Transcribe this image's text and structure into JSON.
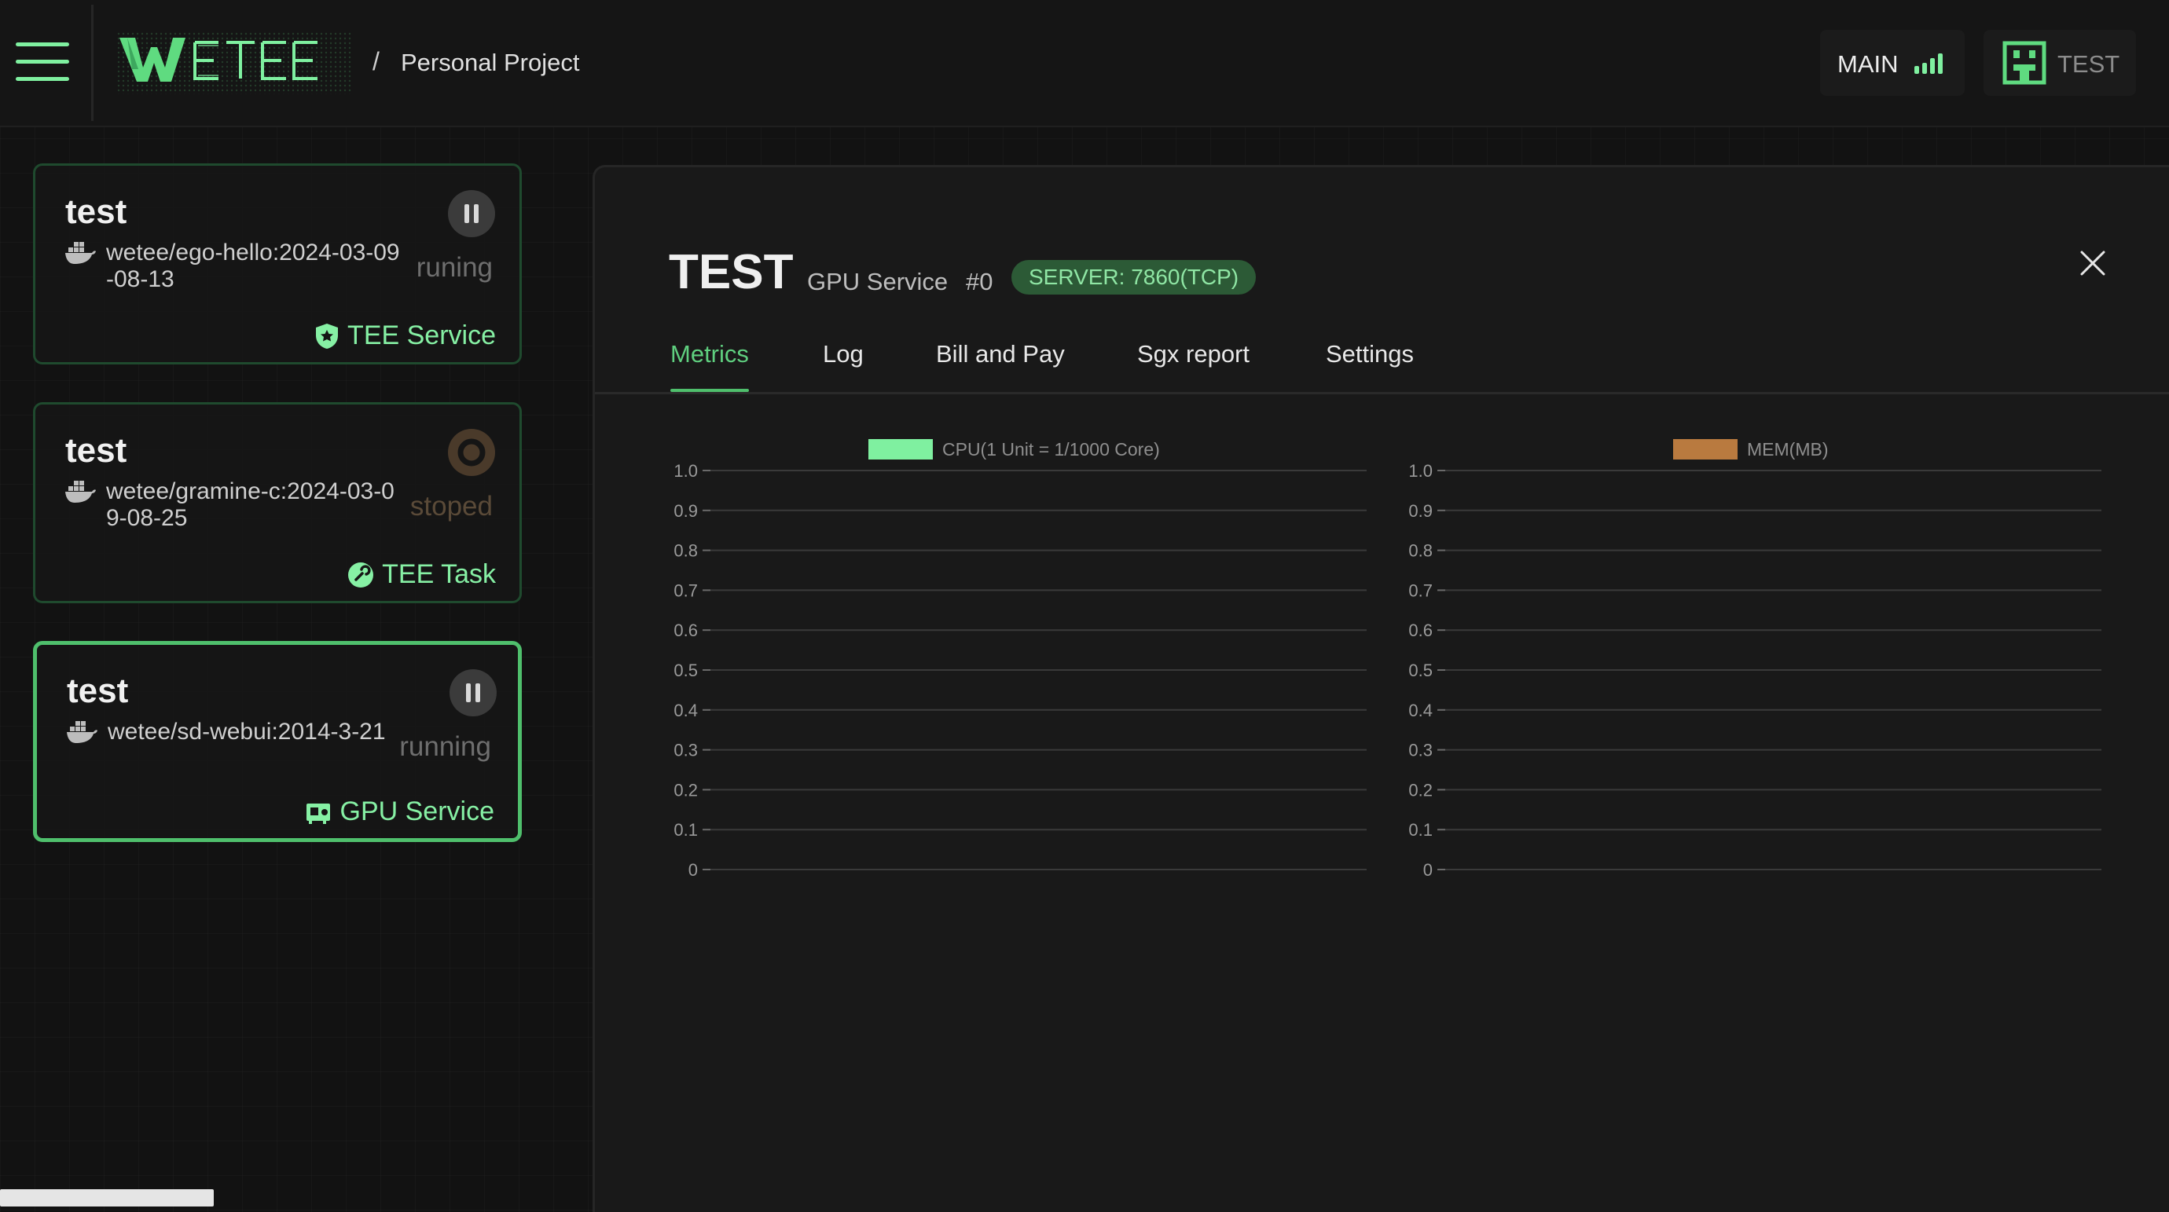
{
  "header": {
    "menu_icon": "hamburger-menu-icon",
    "brand": "WETEE",
    "breadcrumb_separator": "/",
    "project": "Personal Project",
    "network": {
      "label": "MAIN",
      "icon": "signal-bars-icon"
    },
    "account": {
      "name": "TEST",
      "icon": "user-avatar-icon"
    }
  },
  "sidebar": {
    "cards": [
      {
        "title": "test",
        "image": "wetee/ego-hello:2024-03-09-08-13",
        "status": "runing",
        "state_icon": "pause-icon",
        "type": "TEE Service",
        "type_icon": "shield-icon",
        "selected": false
      },
      {
        "title": "test",
        "image": "wetee/gramine-c:2024-03-09-08-25",
        "status": "stoped",
        "state_icon": "stopped-ring-icon",
        "type": "TEE Task",
        "type_icon": "task-icon",
        "selected": false
      },
      {
        "title": "test",
        "image": "wetee/sd-webui:2014-3-21",
        "status": "running",
        "state_icon": "pause-icon",
        "type": "GPU Service",
        "type_icon": "gpu-icon",
        "selected": true
      }
    ]
  },
  "detail": {
    "title": "TEST",
    "kind": "GPU Service",
    "index": "#0",
    "server": "SERVER: 7860(TCP)",
    "tabs": [
      {
        "label": "Metrics",
        "active": true
      },
      {
        "label": "Log",
        "active": false
      },
      {
        "label": "Bill and Pay",
        "active": false
      },
      {
        "label": "Sgx report",
        "active": false
      },
      {
        "label": "Settings",
        "active": false
      }
    ]
  },
  "colors": {
    "accent": "#4fbf6c",
    "accent_light": "#86f0a4",
    "cpu": "#7ff0a0",
    "mem": "#b97a3f",
    "background": "#121212",
    "panel": "#191919"
  },
  "chart_data": [
    {
      "type": "line",
      "series": [
        {
          "name": "CPU(1 Unit = 1/1000 Core)",
          "color": "#7ff0a0",
          "values": []
        }
      ],
      "y_ticks": [
        "1.0",
        "0.9",
        "0.8",
        "0.7",
        "0.6",
        "0.5",
        "0.4",
        "0.3",
        "0.2",
        "0.1",
        "0"
      ],
      "ylim": [
        0,
        1
      ],
      "legend_position": "top",
      "grid": true
    },
    {
      "type": "line",
      "series": [
        {
          "name": "MEM(MB)",
          "color": "#b97a3f",
          "values": []
        }
      ],
      "y_ticks": [
        "1.0",
        "0.9",
        "0.8",
        "0.7",
        "0.6",
        "0.5",
        "0.4",
        "0.3",
        "0.2",
        "0.1",
        "0"
      ],
      "ylim": [
        0,
        1
      ],
      "legend_position": "top",
      "grid": true
    }
  ]
}
